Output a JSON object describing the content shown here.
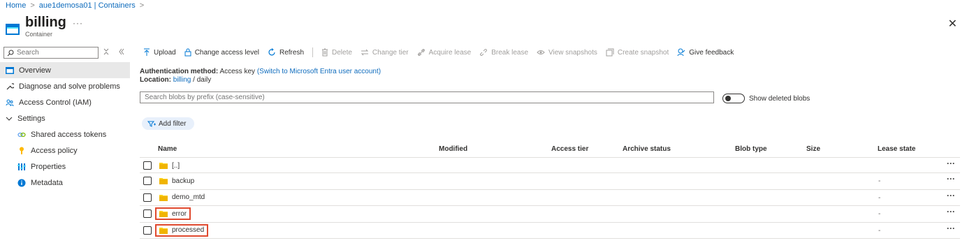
{
  "breadcrumb": {
    "home": "Home",
    "account": "aue1demosa01 | Containers",
    "sep": ">"
  },
  "header": {
    "title": "billing",
    "subtitle": "Container",
    "more": "···",
    "close": "✕"
  },
  "sidebar": {
    "search_placeholder": "Search",
    "items": [
      {
        "label": "Overview",
        "icon": "container-icon"
      },
      {
        "label": "Diagnose and solve problems",
        "icon": "wrench-icon"
      },
      {
        "label": "Access Control (IAM)",
        "icon": "people-icon"
      },
      {
        "label": "Settings",
        "icon": "chevron-down-icon"
      },
      {
        "label": "Shared access tokens",
        "icon": "link-icon"
      },
      {
        "label": "Access policy",
        "icon": "key-icon"
      },
      {
        "label": "Properties",
        "icon": "bars-icon"
      },
      {
        "label": "Metadata",
        "icon": "info-icon"
      }
    ]
  },
  "toolbar": {
    "upload": "Upload",
    "change_access": "Change access level",
    "refresh": "Refresh",
    "delete": "Delete",
    "change_tier": "Change tier",
    "acquire_lease": "Acquire lease",
    "break_lease": "Break lease",
    "view_snapshots": "View snapshots",
    "create_snapshot": "Create snapshot",
    "give_feedback": "Give feedback"
  },
  "auth": {
    "method_label": "Authentication method:",
    "method_value": "Access key",
    "switch_link": "(Switch to Microsoft Entra user account)",
    "location_label": "Location:",
    "location_link": "billing",
    "location_sep": "/",
    "location_path": "daily"
  },
  "blob_search": {
    "placeholder": "Search blobs by prefix (case-sensitive)"
  },
  "show_deleted": {
    "label": "Show deleted blobs",
    "on": false
  },
  "add_filter": "Add filter",
  "columns": [
    "Name",
    "Modified",
    "Access tier",
    "Archive status",
    "Blob type",
    "Size",
    "Lease state"
  ],
  "rows": [
    {
      "name": "[..]",
      "lease": "",
      "highlight": false
    },
    {
      "name": "backup",
      "lease": "-",
      "highlight": false
    },
    {
      "name": "demo_mtd",
      "lease": "-",
      "highlight": false
    },
    {
      "name": "error",
      "lease": "-",
      "highlight": true
    },
    {
      "name": "processed",
      "lease": "-",
      "highlight": true
    }
  ],
  "row_more": "···",
  "colors": {
    "link": "#0f6cbd",
    "folder": "#fcd116",
    "highlight": "#e04a2f",
    "active_bg": "#e8e8e8"
  }
}
